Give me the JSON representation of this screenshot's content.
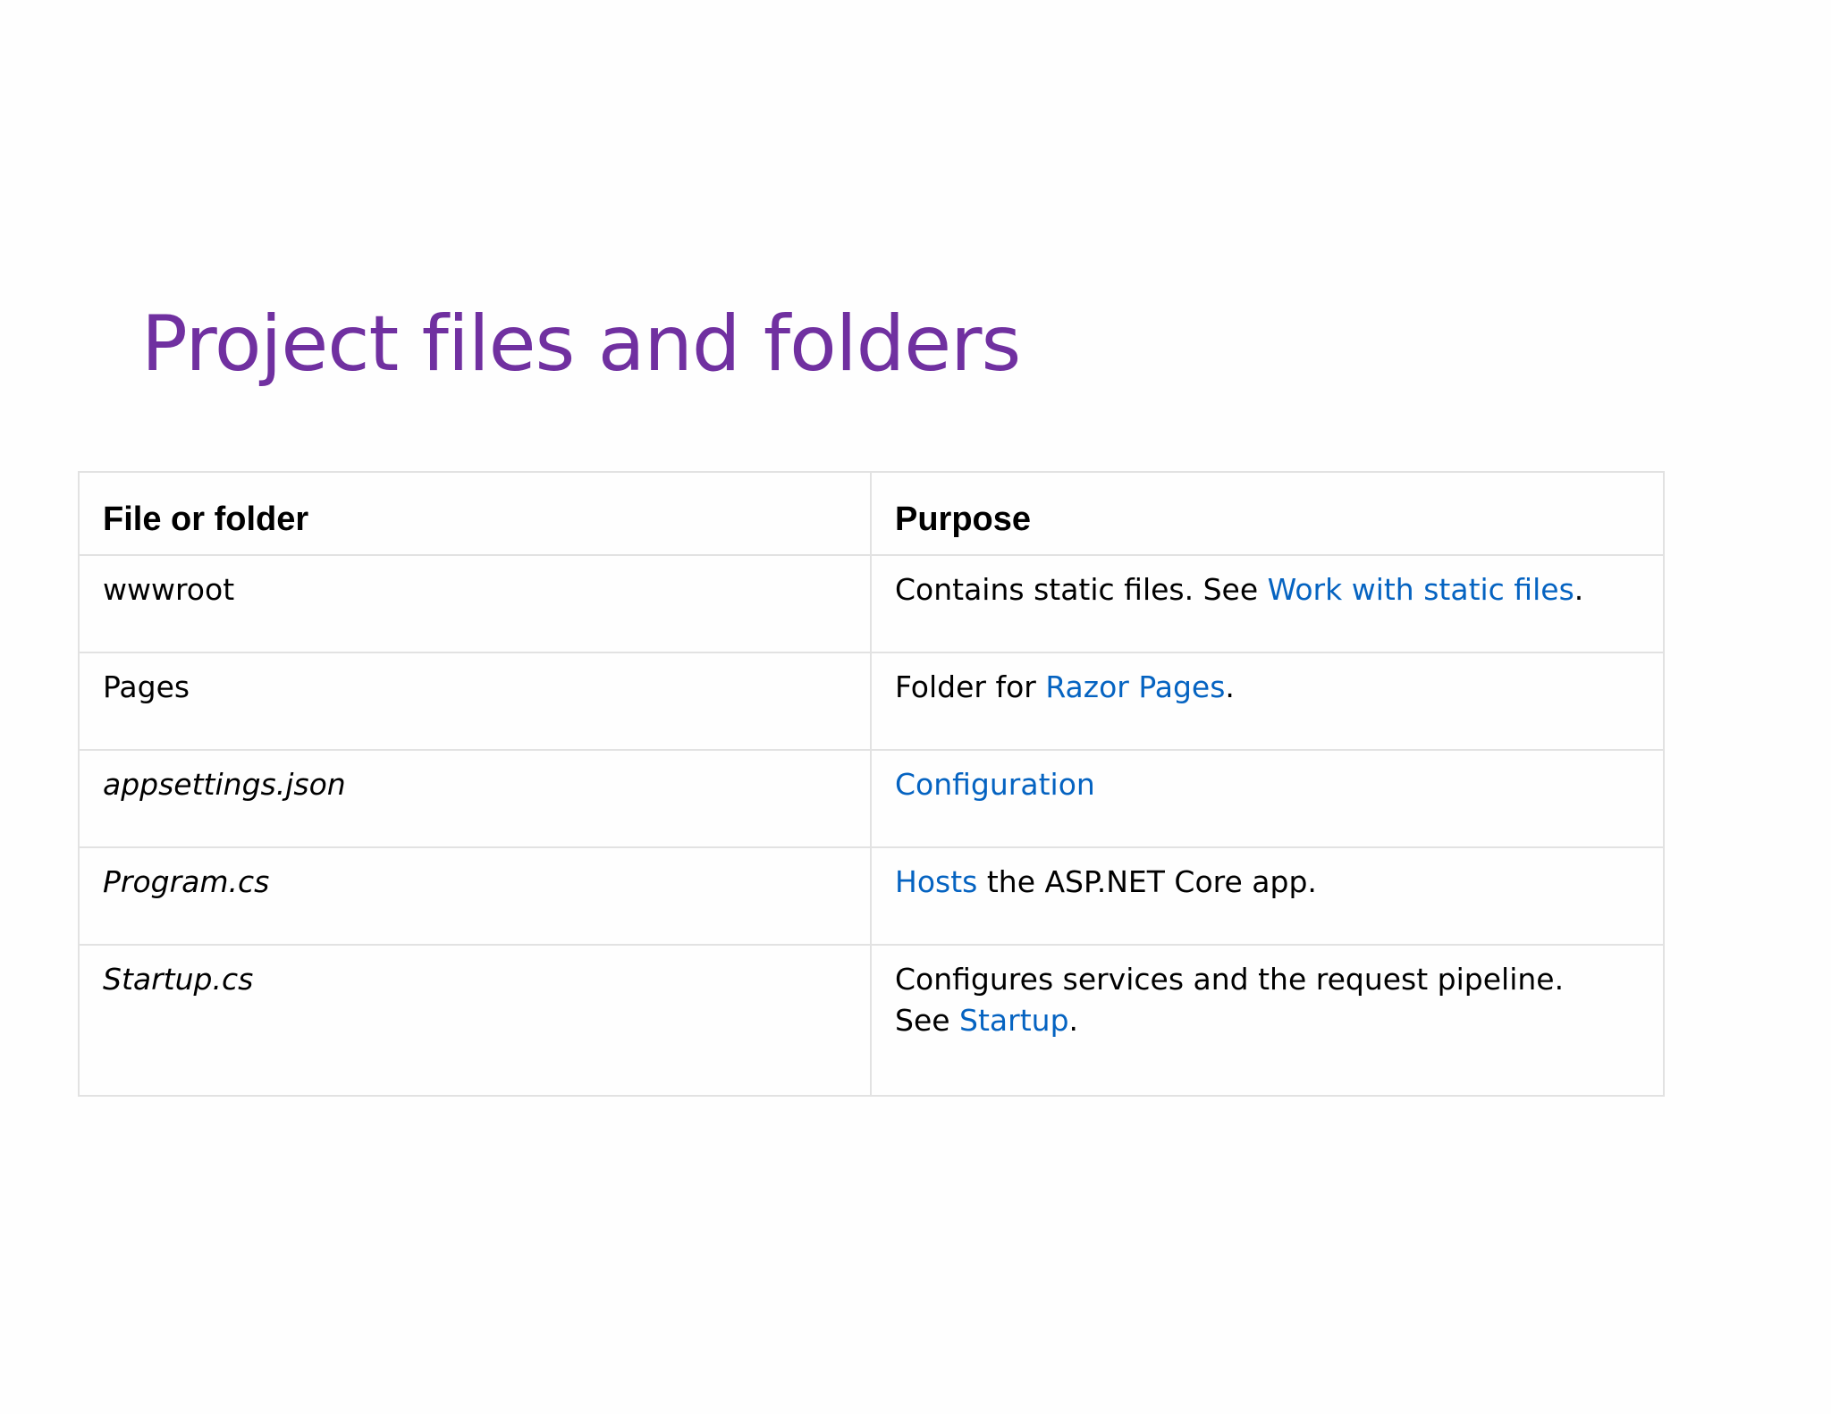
{
  "slide": {
    "title": "Project files and folders"
  },
  "table": {
    "headers": [
      "File or folder",
      "Purpose"
    ],
    "rows": [
      {
        "file": "wwwroot",
        "purpose_prefix": "Contains static files. See ",
        "purpose_link": "Work with static files",
        "purpose_suffix": "."
      },
      {
        "file": "Pages",
        "purpose_prefix": "Folder for ",
        "purpose_link": "Razor Pages",
        "purpose_suffix": "."
      },
      {
        "file": "appsettings.json",
        "purpose_link": "Configuration"
      },
      {
        "file": "Program.cs",
        "purpose_link": "Hosts",
        "purpose_suffix": " the ASP.NET Core app."
      },
      {
        "file": "Startup.cs",
        "purpose_line1": "Configures services and the request pipeline.",
        "purpose_line2_prefix": "See ",
        "purpose_link": "Startup",
        "purpose_suffix": "."
      }
    ]
  },
  "colors": {
    "title": "#7030a0",
    "link": "#0563c1",
    "border": "#e2e2e2"
  }
}
